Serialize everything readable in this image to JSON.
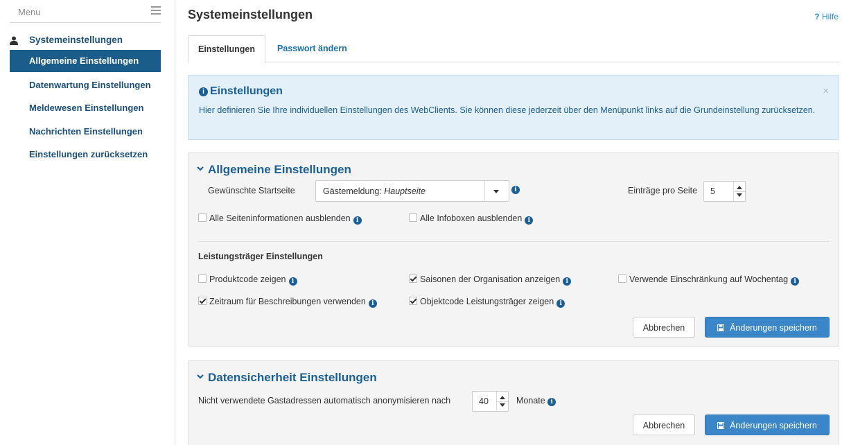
{
  "sidebar": {
    "menu_label": "Menu",
    "heading": "Systemeinstellungen",
    "items": [
      {
        "label": "Allgemeine Einstellungen",
        "active": true
      },
      {
        "label": "Datenwartung Einstellungen",
        "active": false
      },
      {
        "label": "Meldewesen Einstellungen",
        "active": false
      },
      {
        "label": "Nachrichten Einstellungen",
        "active": false
      },
      {
        "label": "Einstellungen zurücksetzen",
        "active": false
      }
    ]
  },
  "header": {
    "title": "Systemeinstellungen",
    "help_mark": "?",
    "help_label": "Hilfe"
  },
  "tabs": [
    {
      "label": "Einstellungen",
      "active": true
    },
    {
      "label": "Passwort ändern",
      "active": false
    }
  ],
  "info_box": {
    "title": "Einstellungen",
    "text": "Hier definieren Sie Ihre individuellen Einstellungen des WebClients. Sie können diese jederzeit über den Menüpunkt links auf die Grundeinstellung zurücksetzen.",
    "close_glyph": "×"
  },
  "general": {
    "title": "Allgemeine Einstellungen",
    "start_page_label": "Gewünschte Startseite",
    "start_page_value_prefix": "Gästemeldung: ",
    "start_page_value_emph": "Hauptseite",
    "entries_label": "Einträge pro Seite",
    "entries_value": "5",
    "hide_page_info_label": "Alle Seiteninformationen ausblenden",
    "hide_page_info_checked": false,
    "hide_infoboxes_label": "Alle Infoboxen ausblenden",
    "hide_infoboxes_checked": false,
    "provider_heading": "Leistungsträger Einstellungen",
    "provider_options": [
      {
        "label": "Produktcode zeigen",
        "checked": false
      },
      {
        "label": "Saisonen der Organisation anzeigen",
        "checked": true
      },
      {
        "label": "Verwende Einschränkung auf Wochentag",
        "checked": false
      },
      {
        "label": "Zeitraum für Beschreibungen verwenden",
        "checked": true
      },
      {
        "label": "Objektcode Leistungsträger zeigen",
        "checked": true
      }
    ],
    "cancel_label": "Abbrechen",
    "save_label": "Änderungen speichern"
  },
  "privacy": {
    "title": "Datensicherheit Einstellungen",
    "anonymize_label": "Nicht verwendete Gastadressen automatisch anonymisieren nach",
    "anonymize_value": "40",
    "months_label": "Monate",
    "cancel_label": "Abbrechen",
    "save_label": "Änderungen speichern"
  },
  "info_icon_glyph": "i",
  "colors": {
    "accent": "#1b5f97",
    "active_nav": "#1a5c8a",
    "primary_button": "#3a86c8",
    "info_bg": "#e3f0fa"
  }
}
